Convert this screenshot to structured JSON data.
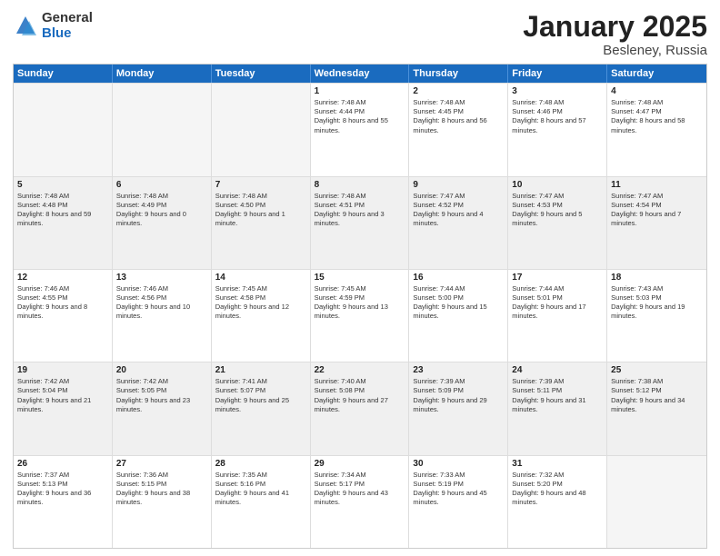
{
  "logo": {
    "general": "General",
    "blue": "Blue"
  },
  "title": {
    "month": "January 2025",
    "location": "Besleney, Russia"
  },
  "weekdays": [
    "Sunday",
    "Monday",
    "Tuesday",
    "Wednesday",
    "Thursday",
    "Friday",
    "Saturday"
  ],
  "rows": [
    [
      {
        "day": "",
        "empty": true
      },
      {
        "day": "",
        "empty": true
      },
      {
        "day": "",
        "empty": true
      },
      {
        "day": "1",
        "rise": "7:48 AM",
        "set": "4:44 PM",
        "daylight": "8 hours and 55 minutes."
      },
      {
        "day": "2",
        "rise": "7:48 AM",
        "set": "4:45 PM",
        "daylight": "8 hours and 56 minutes."
      },
      {
        "day": "3",
        "rise": "7:48 AM",
        "set": "4:46 PM",
        "daylight": "8 hours and 57 minutes."
      },
      {
        "day": "4",
        "rise": "7:48 AM",
        "set": "4:47 PM",
        "daylight": "8 hours and 58 minutes."
      }
    ],
    [
      {
        "day": "5",
        "rise": "7:48 AM",
        "set": "4:48 PM",
        "daylight": "8 hours and 59 minutes."
      },
      {
        "day": "6",
        "rise": "7:48 AM",
        "set": "4:49 PM",
        "daylight": "9 hours and 0 minutes."
      },
      {
        "day": "7",
        "rise": "7:48 AM",
        "set": "4:50 PM",
        "daylight": "9 hours and 1 minute."
      },
      {
        "day": "8",
        "rise": "7:48 AM",
        "set": "4:51 PM",
        "daylight": "9 hours and 3 minutes."
      },
      {
        "day": "9",
        "rise": "7:47 AM",
        "set": "4:52 PM",
        "daylight": "9 hours and 4 minutes."
      },
      {
        "day": "10",
        "rise": "7:47 AM",
        "set": "4:53 PM",
        "daylight": "9 hours and 5 minutes."
      },
      {
        "day": "11",
        "rise": "7:47 AM",
        "set": "4:54 PM",
        "daylight": "9 hours and 7 minutes."
      }
    ],
    [
      {
        "day": "12",
        "rise": "7:46 AM",
        "set": "4:55 PM",
        "daylight": "9 hours and 8 minutes."
      },
      {
        "day": "13",
        "rise": "7:46 AM",
        "set": "4:56 PM",
        "daylight": "9 hours and 10 minutes."
      },
      {
        "day": "14",
        "rise": "7:45 AM",
        "set": "4:58 PM",
        "daylight": "9 hours and 12 minutes."
      },
      {
        "day": "15",
        "rise": "7:45 AM",
        "set": "4:59 PM",
        "daylight": "9 hours and 13 minutes."
      },
      {
        "day": "16",
        "rise": "7:44 AM",
        "set": "5:00 PM",
        "daylight": "9 hours and 15 minutes."
      },
      {
        "day": "17",
        "rise": "7:44 AM",
        "set": "5:01 PM",
        "daylight": "9 hours and 17 minutes."
      },
      {
        "day": "18",
        "rise": "7:43 AM",
        "set": "5:03 PM",
        "daylight": "9 hours and 19 minutes."
      }
    ],
    [
      {
        "day": "19",
        "rise": "7:42 AM",
        "set": "5:04 PM",
        "daylight": "9 hours and 21 minutes."
      },
      {
        "day": "20",
        "rise": "7:42 AM",
        "set": "5:05 PM",
        "daylight": "9 hours and 23 minutes."
      },
      {
        "day": "21",
        "rise": "7:41 AM",
        "set": "5:07 PM",
        "daylight": "9 hours and 25 minutes."
      },
      {
        "day": "22",
        "rise": "7:40 AM",
        "set": "5:08 PM",
        "daylight": "9 hours and 27 minutes."
      },
      {
        "day": "23",
        "rise": "7:39 AM",
        "set": "5:09 PM",
        "daylight": "9 hours and 29 minutes."
      },
      {
        "day": "24",
        "rise": "7:39 AM",
        "set": "5:11 PM",
        "daylight": "9 hours and 31 minutes."
      },
      {
        "day": "25",
        "rise": "7:38 AM",
        "set": "5:12 PM",
        "daylight": "9 hours and 34 minutes."
      }
    ],
    [
      {
        "day": "26",
        "rise": "7:37 AM",
        "set": "5:13 PM",
        "daylight": "9 hours and 36 minutes."
      },
      {
        "day": "27",
        "rise": "7:36 AM",
        "set": "5:15 PM",
        "daylight": "9 hours and 38 minutes."
      },
      {
        "day": "28",
        "rise": "7:35 AM",
        "set": "5:16 PM",
        "daylight": "9 hours and 41 minutes."
      },
      {
        "day": "29",
        "rise": "7:34 AM",
        "set": "5:17 PM",
        "daylight": "9 hours and 43 minutes."
      },
      {
        "day": "30",
        "rise": "7:33 AM",
        "set": "5:19 PM",
        "daylight": "9 hours and 45 minutes."
      },
      {
        "day": "31",
        "rise": "7:32 AM",
        "set": "5:20 PM",
        "daylight": "9 hours and 48 minutes."
      },
      {
        "day": "",
        "empty": true
      }
    ]
  ]
}
